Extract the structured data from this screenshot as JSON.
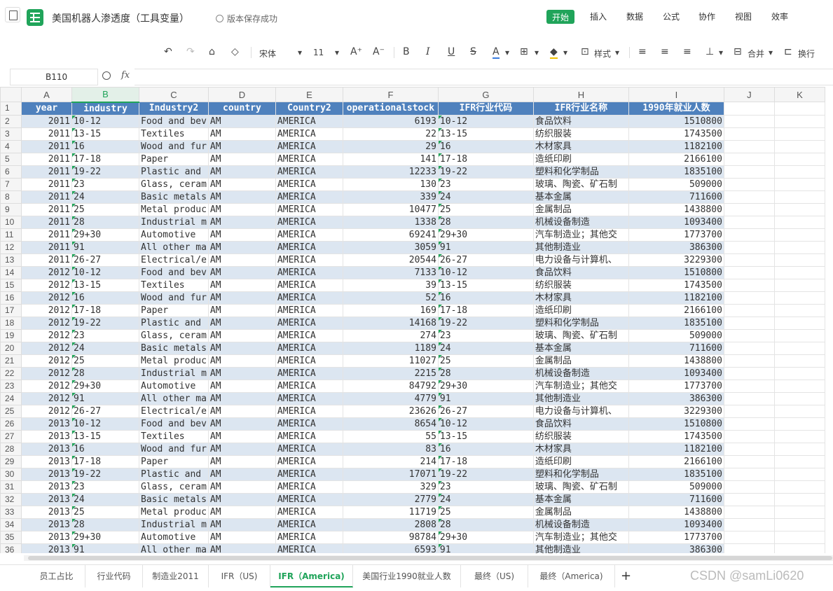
{
  "title_bar": {
    "doc_title": "美国机器人渗透度（工具变量）",
    "save_status": "版本保存成功",
    "menus": [
      "开始",
      "插入",
      "数据",
      "公式",
      "协作",
      "视图",
      "效率"
    ]
  },
  "toolbar": {
    "font_name": "宋体",
    "font_size": "11",
    "style_label": "样式",
    "merge_label": "合并",
    "wrap_label": "换行"
  },
  "formula_bar": {
    "cell_ref": "B110",
    "fx": "fx"
  },
  "columns": [
    "A",
    "B",
    "C",
    "D",
    "E",
    "F",
    "G",
    "H",
    "I",
    "J",
    "K"
  ],
  "headers": [
    "year",
    "industry",
    "Industry2",
    "country",
    "Country2",
    "operationalstock",
    "IFR行业代码",
    "IFR行业名称",
    "1990年就业人数"
  ],
  "rows": [
    [
      "2011",
      "10-12",
      "Food and bev",
      "AM",
      "AMERICA",
      "6193",
      "10-12",
      "食品饮料",
      "1510800"
    ],
    [
      "2011",
      "13-15",
      "Textiles",
      "AM",
      "AMERICA",
      "22",
      "13-15",
      "纺织服装",
      "1743500"
    ],
    [
      "2011",
      "16",
      "Wood and fur",
      "AM",
      "AMERICA",
      "29",
      "16",
      "木材家具",
      "1182100"
    ],
    [
      "2011",
      "17-18",
      "Paper",
      "AM",
      "AMERICA",
      "141",
      "17-18",
      "造纸印刷",
      "2166100"
    ],
    [
      "2011",
      "19-22",
      "Plastic and",
      "AM",
      "AMERICA",
      "12233",
      "19-22",
      "塑料和化学制品",
      "1835100"
    ],
    [
      "2011",
      "23",
      "Glass, ceram",
      "AM",
      "AMERICA",
      "130",
      "23",
      "玻璃、陶瓷、矿石制",
      "509000"
    ],
    [
      "2011",
      "24",
      "Basic metals",
      "AM",
      "AMERICA",
      "339",
      "24",
      "基本金属",
      "711600"
    ],
    [
      "2011",
      "25",
      "Metal produc",
      "AM",
      "AMERICA",
      "10477",
      "25",
      "金属制品",
      "1438800"
    ],
    [
      "2011",
      "28",
      "Industrial m",
      "AM",
      "AMERICA",
      "1338",
      "28",
      "机械设备制造",
      "1093400"
    ],
    [
      "2011",
      "29+30",
      "Automotive",
      "AM",
      "AMERICA",
      "69241",
      "29+30",
      "汽车制造业；其他交",
      "1773700"
    ],
    [
      "2011",
      "91",
      "All other ma",
      "AM",
      "AMERICA",
      "3059",
      "91",
      "其他制造业",
      "386300"
    ],
    [
      "2011",
      "26-27",
      "Electrical/e",
      "AM",
      "AMERICA",
      "20544",
      "26-27",
      "电力设备与计算机、",
      "3229300"
    ],
    [
      "2012",
      "10-12",
      "Food and bev",
      "AM",
      "AMERICA",
      "7133",
      "10-12",
      "食品饮料",
      "1510800"
    ],
    [
      "2012",
      "13-15",
      "Textiles",
      "AM",
      "AMERICA",
      "39",
      "13-15",
      "纺织服装",
      "1743500"
    ],
    [
      "2012",
      "16",
      "Wood and fur",
      "AM",
      "AMERICA",
      "52",
      "16",
      "木材家具",
      "1182100"
    ],
    [
      "2012",
      "17-18",
      "Paper",
      "AM",
      "AMERICA",
      "169",
      "17-18",
      "造纸印刷",
      "2166100"
    ],
    [
      "2012",
      "19-22",
      "Plastic and",
      "AM",
      "AMERICA",
      "14168",
      "19-22",
      "塑料和化学制品",
      "1835100"
    ],
    [
      "2012",
      "23",
      "Glass, ceram",
      "AM",
      "AMERICA",
      "274",
      "23",
      "玻璃、陶瓷、矿石制",
      "509000"
    ],
    [
      "2012",
      "24",
      "Basic metals",
      "AM",
      "AMERICA",
      "1189",
      "24",
      "基本金属",
      "711600"
    ],
    [
      "2012",
      "25",
      "Metal produc",
      "AM",
      "AMERICA",
      "11027",
      "25",
      "金属制品",
      "1438800"
    ],
    [
      "2012",
      "28",
      "Industrial m",
      "AM",
      "AMERICA",
      "2215",
      "28",
      "机械设备制造",
      "1093400"
    ],
    [
      "2012",
      "29+30",
      "Automotive",
      "AM",
      "AMERICA",
      "84792",
      "29+30",
      "汽车制造业；其他交",
      "1773700"
    ],
    [
      "2012",
      "91",
      "All other ma",
      "AM",
      "AMERICA",
      "4779",
      "91",
      "其他制造业",
      "386300"
    ],
    [
      "2012",
      "26-27",
      "Electrical/e",
      "AM",
      "AMERICA",
      "23626",
      "26-27",
      "电力设备与计算机、",
      "3229300"
    ],
    [
      "2013",
      "10-12",
      "Food and bev",
      "AM",
      "AMERICA",
      "8654",
      "10-12",
      "食品饮料",
      "1510800"
    ],
    [
      "2013",
      "13-15",
      "Textiles",
      "AM",
      "AMERICA",
      "55",
      "13-15",
      "纺织服装",
      "1743500"
    ],
    [
      "2013",
      "16",
      "Wood and fur",
      "AM",
      "AMERICA",
      "83",
      "16",
      "木材家具",
      "1182100"
    ],
    [
      "2013",
      "17-18",
      "Paper",
      "AM",
      "AMERICA",
      "214",
      "17-18",
      "造纸印刷",
      "2166100"
    ],
    [
      "2013",
      "19-22",
      "Plastic and",
      "AM",
      "AMERICA",
      "17071",
      "19-22",
      "塑料和化学制品",
      "1835100"
    ],
    [
      "2013",
      "23",
      "Glass, ceram",
      "AM",
      "AMERICA",
      "329",
      "23",
      "玻璃、陶瓷、矿石制",
      "509000"
    ],
    [
      "2013",
      "24",
      "Basic metals",
      "AM",
      "AMERICA",
      "2779",
      "24",
      "基本金属",
      "711600"
    ],
    [
      "2013",
      "25",
      "Metal produc",
      "AM",
      "AMERICA",
      "11719",
      "25",
      "金属制品",
      "1438800"
    ],
    [
      "2013",
      "28",
      "Industrial m",
      "AM",
      "AMERICA",
      "2808",
      "28",
      "机械设备制造",
      "1093400"
    ],
    [
      "2013",
      "29+30",
      "Automotive",
      "AM",
      "AMERICA",
      "98784",
      "29+30",
      "汽车制造业；其他交",
      "1773700"
    ],
    [
      "2013",
      "91",
      "All other ma",
      "AM",
      "AMERICA",
      "6593",
      "91",
      "其他制造业",
      "386300"
    ]
  ],
  "sheet_tabs": [
    "员工占比",
    "行业代码",
    "制造业2011",
    "IFR（US)",
    "IFR（America)",
    "美国行业1990就业人数",
    "最终（US)",
    "最终（America)"
  ],
  "active_tab": 4,
  "watermark": "CSDN @samLi0620",
  "colors": {
    "accent": "#20a45a",
    "header_fill": "#4f81bd",
    "band_fill": "#dce6f1"
  }
}
